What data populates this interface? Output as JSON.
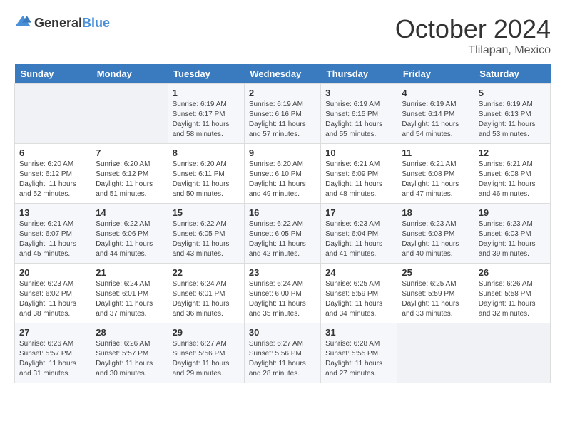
{
  "header": {
    "logo_general": "General",
    "logo_blue": "Blue",
    "month_title": "October 2024",
    "location": "Tlilapan, Mexico"
  },
  "days_of_week": [
    "Sunday",
    "Monday",
    "Tuesday",
    "Wednesday",
    "Thursday",
    "Friday",
    "Saturday"
  ],
  "weeks": [
    [
      {
        "day": "",
        "empty": true
      },
      {
        "day": "",
        "empty": true
      },
      {
        "day": "1",
        "sunrise": "6:19 AM",
        "sunset": "6:17 PM",
        "daylight": "11 hours and 58 minutes."
      },
      {
        "day": "2",
        "sunrise": "6:19 AM",
        "sunset": "6:16 PM",
        "daylight": "11 hours and 57 minutes."
      },
      {
        "day": "3",
        "sunrise": "6:19 AM",
        "sunset": "6:15 PM",
        "daylight": "11 hours and 55 minutes."
      },
      {
        "day": "4",
        "sunrise": "6:19 AM",
        "sunset": "6:14 PM",
        "daylight": "11 hours and 54 minutes."
      },
      {
        "day": "5",
        "sunrise": "6:19 AM",
        "sunset": "6:13 PM",
        "daylight": "11 hours and 53 minutes."
      }
    ],
    [
      {
        "day": "6",
        "sunrise": "6:20 AM",
        "sunset": "6:12 PM",
        "daylight": "11 hours and 52 minutes."
      },
      {
        "day": "7",
        "sunrise": "6:20 AM",
        "sunset": "6:12 PM",
        "daylight": "11 hours and 51 minutes."
      },
      {
        "day": "8",
        "sunrise": "6:20 AM",
        "sunset": "6:11 PM",
        "daylight": "11 hours and 50 minutes."
      },
      {
        "day": "9",
        "sunrise": "6:20 AM",
        "sunset": "6:10 PM",
        "daylight": "11 hours and 49 minutes."
      },
      {
        "day": "10",
        "sunrise": "6:21 AM",
        "sunset": "6:09 PM",
        "daylight": "11 hours and 48 minutes."
      },
      {
        "day": "11",
        "sunrise": "6:21 AM",
        "sunset": "6:08 PM",
        "daylight": "11 hours and 47 minutes."
      },
      {
        "day": "12",
        "sunrise": "6:21 AM",
        "sunset": "6:08 PM",
        "daylight": "11 hours and 46 minutes."
      }
    ],
    [
      {
        "day": "13",
        "sunrise": "6:21 AM",
        "sunset": "6:07 PM",
        "daylight": "11 hours and 45 minutes."
      },
      {
        "day": "14",
        "sunrise": "6:22 AM",
        "sunset": "6:06 PM",
        "daylight": "11 hours and 44 minutes."
      },
      {
        "day": "15",
        "sunrise": "6:22 AM",
        "sunset": "6:05 PM",
        "daylight": "11 hours and 43 minutes."
      },
      {
        "day": "16",
        "sunrise": "6:22 AM",
        "sunset": "6:05 PM",
        "daylight": "11 hours and 42 minutes."
      },
      {
        "day": "17",
        "sunrise": "6:23 AM",
        "sunset": "6:04 PM",
        "daylight": "11 hours and 41 minutes."
      },
      {
        "day": "18",
        "sunrise": "6:23 AM",
        "sunset": "6:03 PM",
        "daylight": "11 hours and 40 minutes."
      },
      {
        "day": "19",
        "sunrise": "6:23 AM",
        "sunset": "6:03 PM",
        "daylight": "11 hours and 39 minutes."
      }
    ],
    [
      {
        "day": "20",
        "sunrise": "6:23 AM",
        "sunset": "6:02 PM",
        "daylight": "11 hours and 38 minutes."
      },
      {
        "day": "21",
        "sunrise": "6:24 AM",
        "sunset": "6:01 PM",
        "daylight": "11 hours and 37 minutes."
      },
      {
        "day": "22",
        "sunrise": "6:24 AM",
        "sunset": "6:01 PM",
        "daylight": "11 hours and 36 minutes."
      },
      {
        "day": "23",
        "sunrise": "6:24 AM",
        "sunset": "6:00 PM",
        "daylight": "11 hours and 35 minutes."
      },
      {
        "day": "24",
        "sunrise": "6:25 AM",
        "sunset": "5:59 PM",
        "daylight": "11 hours and 34 minutes."
      },
      {
        "day": "25",
        "sunrise": "6:25 AM",
        "sunset": "5:59 PM",
        "daylight": "11 hours and 33 minutes."
      },
      {
        "day": "26",
        "sunrise": "6:26 AM",
        "sunset": "5:58 PM",
        "daylight": "11 hours and 32 minutes."
      }
    ],
    [
      {
        "day": "27",
        "sunrise": "6:26 AM",
        "sunset": "5:57 PM",
        "daylight": "11 hours and 31 minutes."
      },
      {
        "day": "28",
        "sunrise": "6:26 AM",
        "sunset": "5:57 PM",
        "daylight": "11 hours and 30 minutes."
      },
      {
        "day": "29",
        "sunrise": "6:27 AM",
        "sunset": "5:56 PM",
        "daylight": "11 hours and 29 minutes."
      },
      {
        "day": "30",
        "sunrise": "6:27 AM",
        "sunset": "5:56 PM",
        "daylight": "11 hours and 28 minutes."
      },
      {
        "day": "31",
        "sunrise": "6:28 AM",
        "sunset": "5:55 PM",
        "daylight": "11 hours and 27 minutes."
      },
      {
        "day": "",
        "empty": true
      },
      {
        "day": "",
        "empty": true
      }
    ]
  ],
  "labels": {
    "sunrise": "Sunrise: ",
    "sunset": "Sunset: ",
    "daylight": "Daylight: "
  }
}
